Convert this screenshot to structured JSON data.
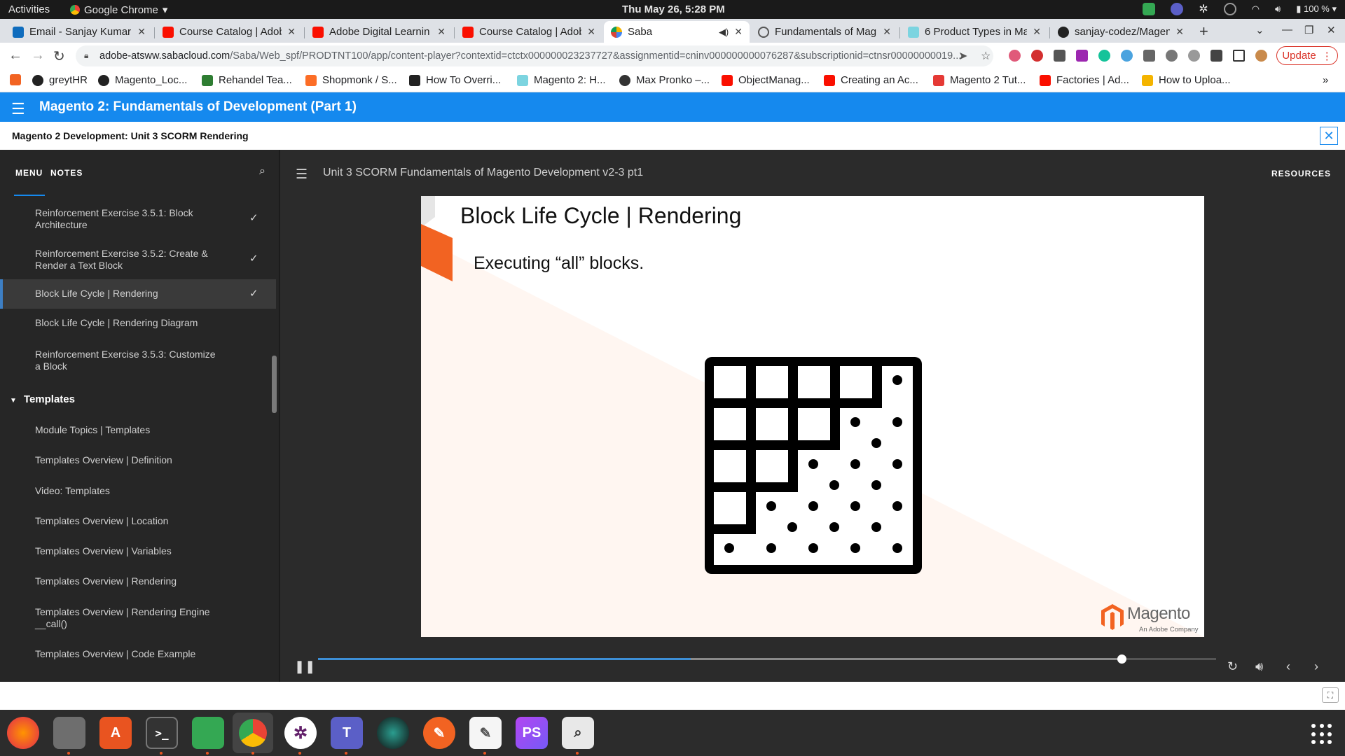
{
  "system": {
    "activities": "Activities",
    "app_menu": "Google Chrome",
    "clock": "Thu May 26,  5:28 PM",
    "battery": "100 %"
  },
  "tabs": [
    {
      "label": "Email - Sanjay Kumar I",
      "active": false
    },
    {
      "label": "Course Catalog | Adob",
      "active": false
    },
    {
      "label": "Adobe Digital Learnin",
      "active": false
    },
    {
      "label": "Course Catalog | Adob",
      "active": false
    },
    {
      "label": "Saba",
      "active": true
    },
    {
      "label": "Fundamentals of Mag",
      "active": false
    },
    {
      "label": "6 Product Types in Ma",
      "active": false
    },
    {
      "label": "sanjay-codez/Magent",
      "active": false
    }
  ],
  "omnibox": {
    "domain": "adobe-atsww.sabacloud.com",
    "path": "/Saba/Web_spf/PRODTNT100/app/content-player?contextid=ctctx000000023237727&assignmentid=cninv000000000076287&subscriptionid=ctnsr00000000019..."
  },
  "update_label": "Update",
  "bookmarks": [
    {
      "label": "greytHR"
    },
    {
      "label": "Magento_Loc..."
    },
    {
      "label": "Rehandel Tea..."
    },
    {
      "label": "Shopmonk / S..."
    },
    {
      "label": "How To Overri..."
    },
    {
      "label": "Magento 2: H..."
    },
    {
      "label": "Max Pronko –..."
    },
    {
      "label": "ObjectManag..."
    },
    {
      "label": "Creating an Ac..."
    },
    {
      "label": "Magento 2 Tut..."
    },
    {
      "label": "Factories | Ad..."
    },
    {
      "label": "How to Uploa..."
    }
  ],
  "course": {
    "title": "Magento 2: Fundamentals of Development (Part 1)",
    "subtitle": "Magento 2 Development: Unit 3 SCORM Rendering"
  },
  "sidebar": {
    "tab_menu": "MENU",
    "tab_notes": "NOTES",
    "items": [
      {
        "label": "Reinforcement Exercise 3.5.1: Block Architecture",
        "done": true
      },
      {
        "label": "Reinforcement Exercise 3.5.2: Create & Render a Text Block",
        "done": true
      },
      {
        "label": "Block Life Cycle | Rendering",
        "done": true
      },
      {
        "label": "Block Life Cycle | Rendering Diagram",
        "done": false
      },
      {
        "label": "Reinforcement Exercise 3.5.3: Customize a Block",
        "done": false
      }
    ],
    "section": "Templates",
    "section_items": [
      {
        "label": "Module Topics | Templates"
      },
      {
        "label": "Templates Overview | Definition"
      },
      {
        "label": "Video: Templates"
      },
      {
        "label": "Templates Overview | Location"
      },
      {
        "label": "Templates Overview | Variables"
      },
      {
        "label": "Templates Overview | Rendering"
      },
      {
        "label": "Templates Overview | Rendering Engine __call()"
      },
      {
        "label": "Templates Overview | Code Example"
      }
    ]
  },
  "player": {
    "title": "Unit 3 SCORM Fundamentals of Magento Development v2-3 pt1",
    "resources": "RESOURCES",
    "progress_played": 0.895,
    "progress_buffered": 0.415
  },
  "slide": {
    "title": "Block Life Cycle | Rendering",
    "bullet": "Executing “all” blocks.",
    "logo_text": "Magento",
    "logo_sub": "An Adobe Company",
    "accent": "#f26322"
  }
}
